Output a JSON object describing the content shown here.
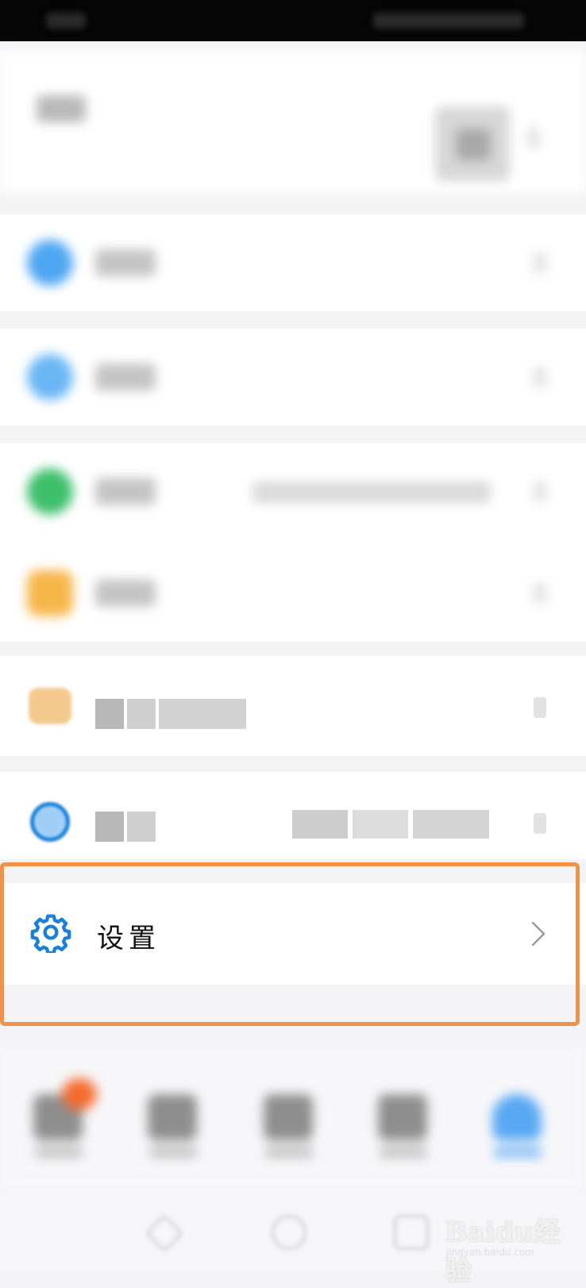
{
  "settings_row": {
    "label": "设置",
    "icon": "gear-icon",
    "chevron": "chevron-right-icon",
    "icon_color": "#1a7fd9"
  },
  "highlight": {
    "color": "#ef934a"
  },
  "colors": {
    "status_bar": "#050505",
    "background": "#f4f4f6",
    "card": "#ffffff",
    "badge": "#f56a2e",
    "accent_blue": "#4fa6f2",
    "accent_green": "#3dbf6a",
    "accent_orange": "#f7b64a"
  },
  "watermark": {
    "text": "Baidu经验",
    "subtext": "jingyan.baidu.com"
  }
}
